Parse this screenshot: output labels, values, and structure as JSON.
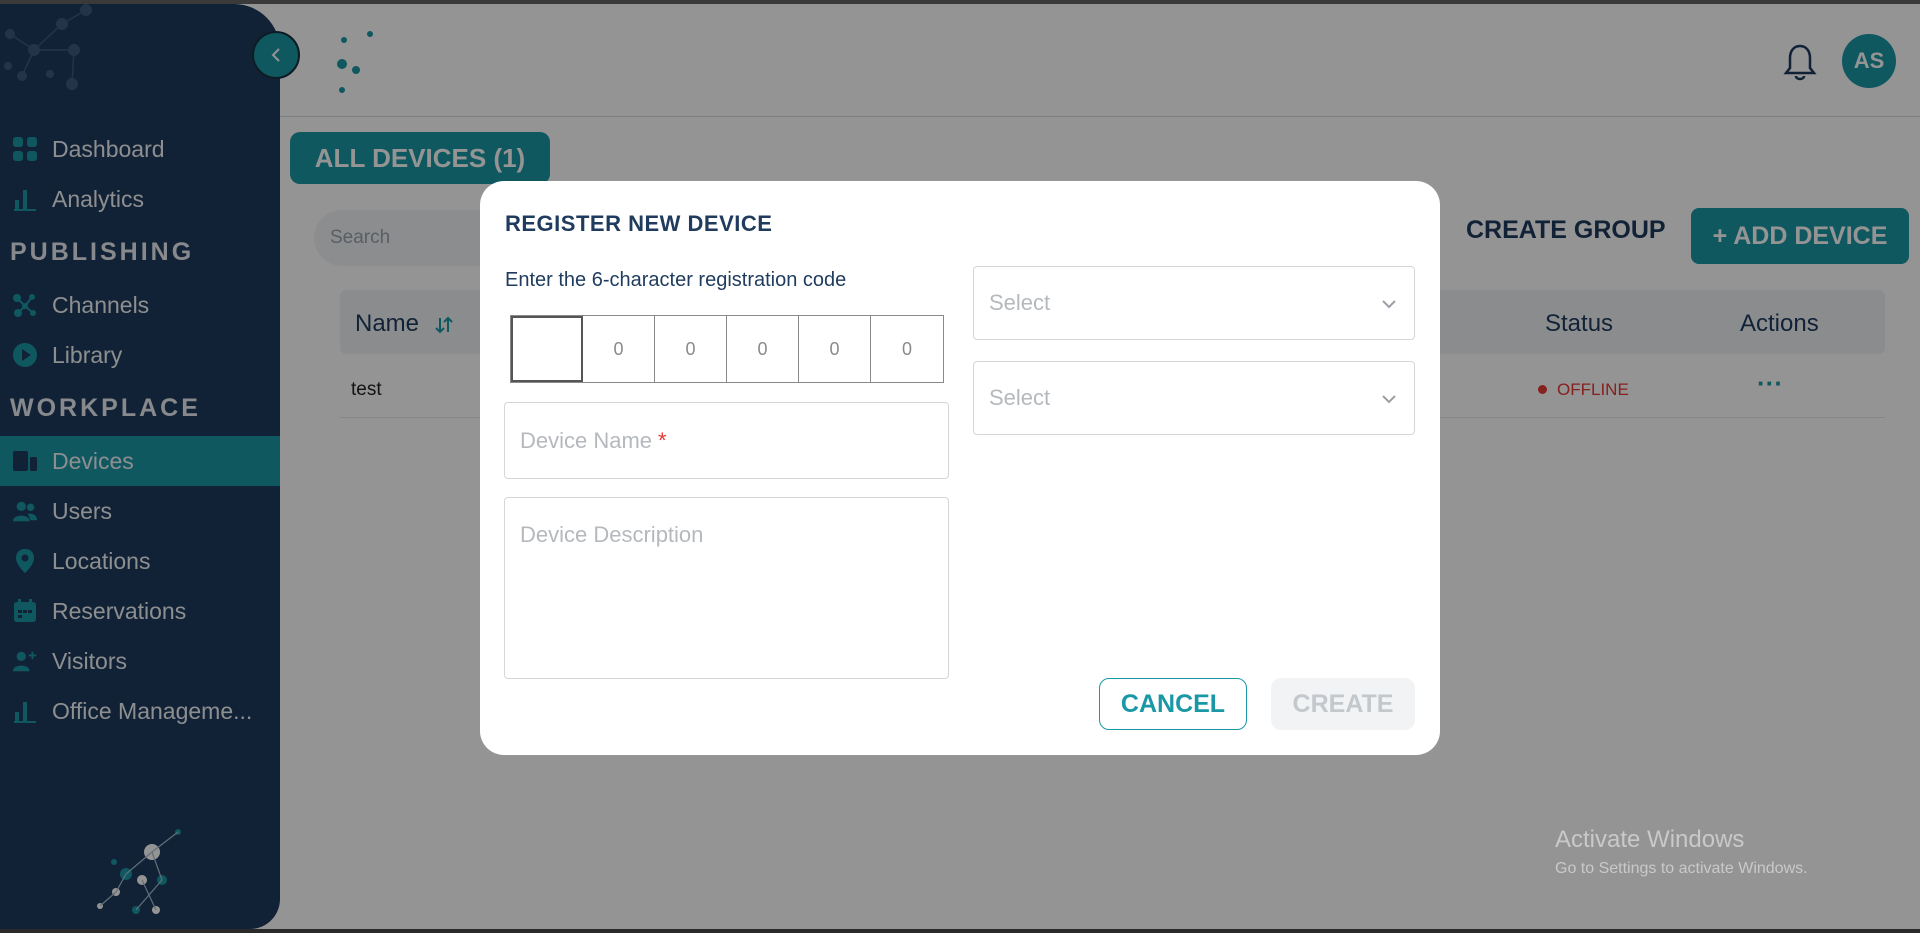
{
  "sidebar": {
    "items": [
      {
        "label": "Dashboard",
        "icon": "dashboard-icon"
      },
      {
        "label": "Analytics",
        "icon": "analytics-icon"
      },
      {
        "section": "PUBLISHING"
      },
      {
        "label": "Channels",
        "icon": "channels-icon"
      },
      {
        "label": "Library",
        "icon": "library-icon"
      },
      {
        "section": "WORKPLACE"
      },
      {
        "label": "Devices",
        "icon": "devices-icon",
        "active": true
      },
      {
        "label": "Users",
        "icon": "users-icon"
      },
      {
        "label": "Locations",
        "icon": "location-pin-icon"
      },
      {
        "label": "Reservations",
        "icon": "calendar-icon"
      },
      {
        "label": "Visitors",
        "icon": "visitor-icon"
      },
      {
        "label": "Office Manageme...",
        "icon": "office-chart-icon"
      }
    ]
  },
  "header": {
    "avatar_initials": "AS"
  },
  "main": {
    "tab_label": "ALL DEVICES (1)",
    "search_placeholder": "Search",
    "create_group_label": "CREATE GROUP",
    "add_device_label": "+ ADD DEVICE",
    "columns": {
      "name": "Name",
      "status": "Status",
      "actions": "Actions"
    },
    "rows": [
      {
        "name": "test",
        "status": "OFFLINE",
        "actions": "···"
      }
    ]
  },
  "modal": {
    "title": "REGISTER NEW DEVICE",
    "code_label": "Enter the 6-character registration code",
    "code_digits": [
      "",
      "0",
      "0",
      "0",
      "0",
      "0"
    ],
    "device_name_placeholder": "Device Name",
    "required_mark": "*",
    "device_description_placeholder": "Device Description",
    "select_1_placeholder": "Select",
    "select_2_placeholder": "Select",
    "cancel_label": "CANCEL",
    "create_label": "CREATE"
  },
  "watermark": {
    "line1": "Activate Windows",
    "line2": "Go to Settings to activate Windows."
  },
  "colors": {
    "sidebar": "#1f3b5e",
    "accent": "#1a98a6",
    "offline": "#e53935"
  }
}
